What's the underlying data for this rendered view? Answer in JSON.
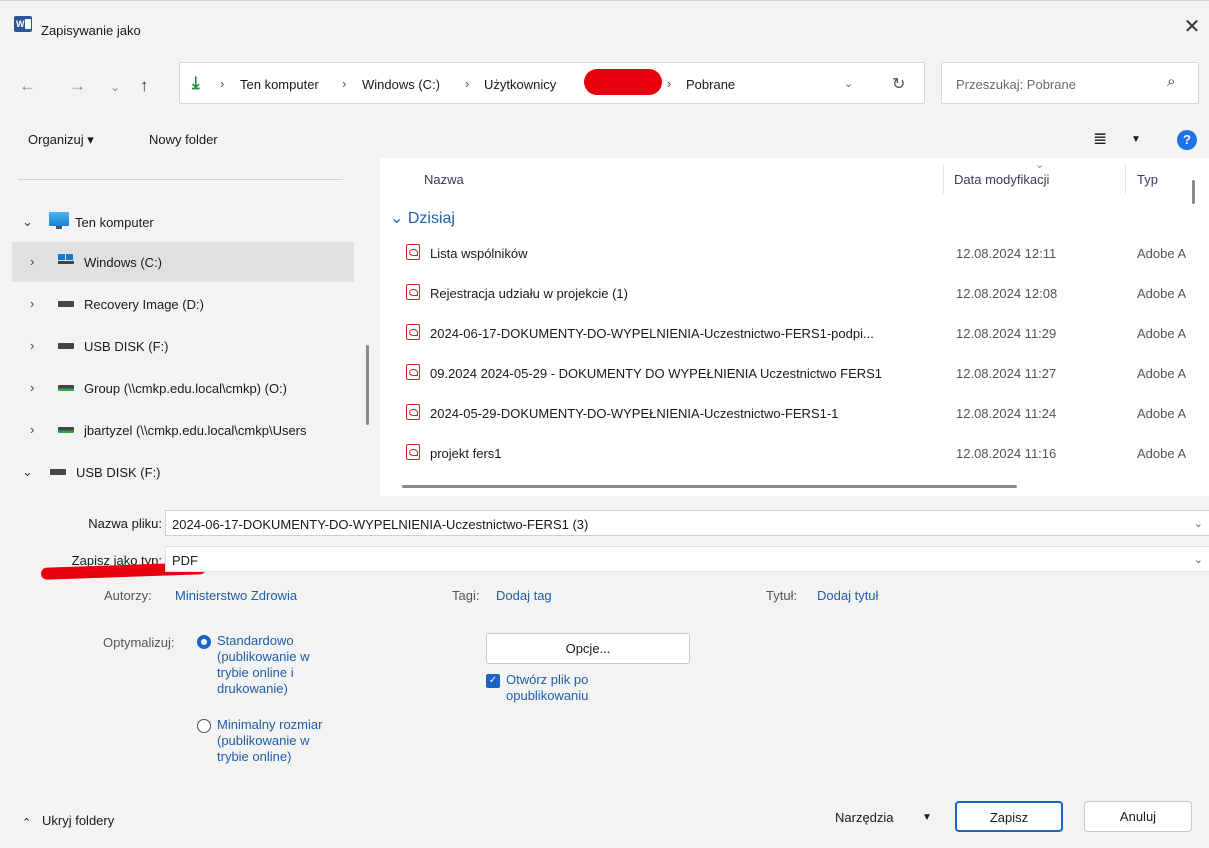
{
  "window": {
    "title": "Zapisywanie jako",
    "close_glyph": "✕"
  },
  "nav": {
    "back_glyph": "←",
    "forward_glyph": "→",
    "recent_glyph": "⌄",
    "up_glyph": "↑",
    "breadcrumbs": [
      "Ten komputer",
      "Windows (C:)",
      "Użytkownicy",
      "Pobrane"
    ],
    "search_placeholder": "Przeszukaj: Pobrane"
  },
  "toolbar": {
    "organize_label": "Organizuj ▾",
    "new_folder_label": "Nowy folder"
  },
  "sidebar": {
    "items": [
      {
        "label": "Ten komputer",
        "chevron": "⌄"
      },
      {
        "label": "Windows (C:)",
        "chevron": "›"
      },
      {
        "label": "Recovery Image (D:)",
        "chevron": "›"
      },
      {
        "label": "USB DISK (F:)",
        "chevron": "›"
      },
      {
        "label": "Group (\\\\cmkp.edu.local\\cmkp) (O:)",
        "chevron": "›"
      },
      {
        "label": "jbartyzel (\\\\cmkp.edu.local\\cmkp\\Users",
        "chevron": "›"
      },
      {
        "label": "USB DISK (F:)",
        "chevron": "⌄"
      }
    ]
  },
  "filelist": {
    "columns": {
      "name": "Nazwa",
      "date": "Data modyfikacji",
      "type": "Typ"
    },
    "group": "Dzisiaj",
    "rows": [
      {
        "name": "Lista wspólników",
        "date": "12.08.2024 12:11",
        "type": "Adobe A"
      },
      {
        "name": "Rejestracja udziału w projekcie (1)",
        "date": "12.08.2024 12:08",
        "type": "Adobe A"
      },
      {
        "name": "2024-06-17-DOKUMENTY-DO-WYPELNIENIA-Uczestnictwo-FERS1-podpi...",
        "date": "12.08.2024 11:29",
        "type": "Adobe A"
      },
      {
        "name": "09.2024  2024-05-29 - DOKUMENTY DO WYPEŁNIENIA Uczestnictwo FERS1",
        "date": "12.08.2024 11:27",
        "type": "Adobe A"
      },
      {
        "name": "2024-05-29-DOKUMENTY-DO-WYPEŁNIENIA-Uczestnictwo-FERS1-1",
        "date": "12.08.2024 11:24",
        "type": "Adobe A"
      },
      {
        "name": "projekt fers1",
        "date": "12.08.2024 11:16",
        "type": "Adobe A"
      }
    ]
  },
  "form": {
    "filename_label": "Nazwa pliku:",
    "filename_value": "2024-06-17-DOKUMENTY-DO-WYPELNIENIA-Uczestnictwo-FERS1 (3)",
    "type_label": "Zapisz jako typ:",
    "type_value": "PDF",
    "authors_label": "Autorzy:",
    "authors_value": "Ministerstwo Zdrowia",
    "tags_label": "Tagi:",
    "tags_value": "Dodaj tag",
    "title_label": "Tytuł:",
    "title_value": "Dodaj tytuł",
    "optimize_label": "Optymalizuj:",
    "opt_standard": [
      "Standardowo",
      "(publikowanie w",
      "trybie online i",
      "drukowanie)"
    ],
    "opt_minimal": [
      "Minimalny rozmiar",
      "(publikowanie w",
      "trybie online)"
    ],
    "options_button": "Opcje...",
    "open_after": [
      "Otwórz plik po",
      "opublikowaniu"
    ]
  },
  "footer": {
    "hide_folders": "Ukryj foldery",
    "tools": "Narzędzia",
    "save": "Zapisz",
    "cancel": "Anuluj"
  }
}
